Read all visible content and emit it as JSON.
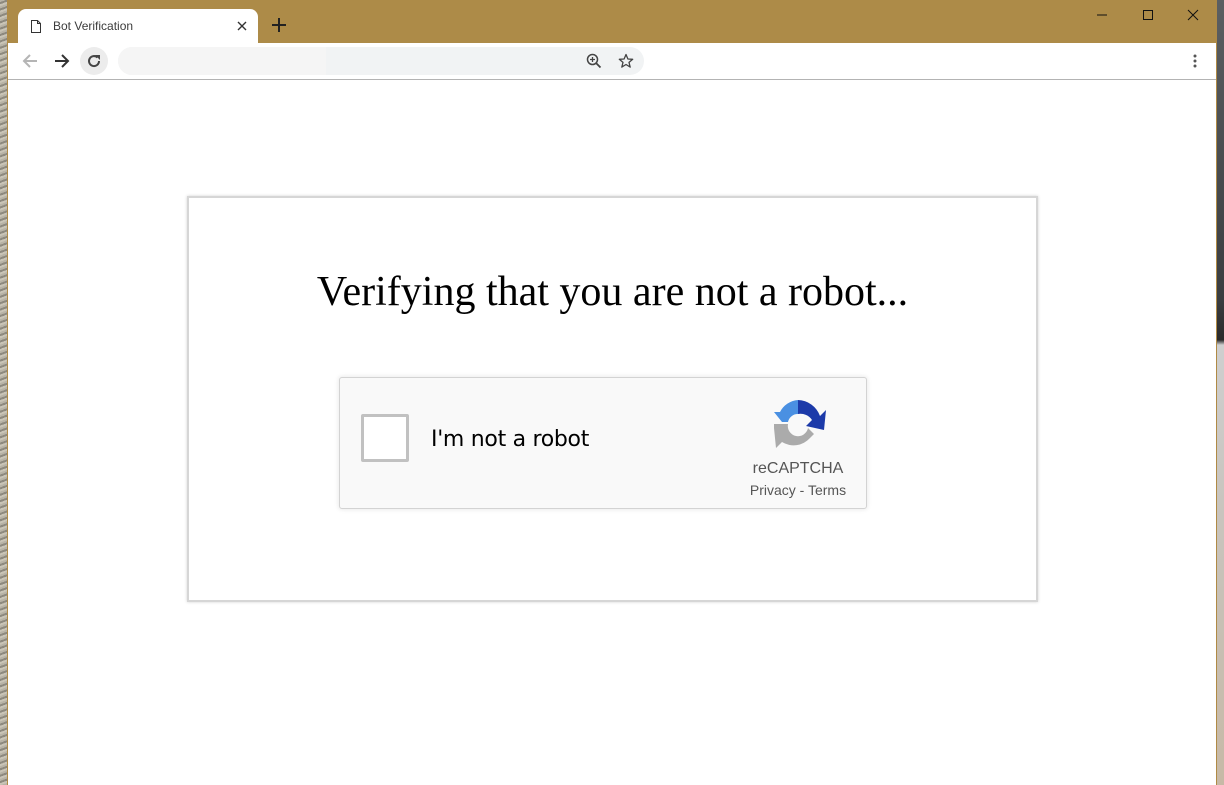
{
  "browser": {
    "tab": {
      "title": "Bot Verification",
      "icon": "page-icon",
      "close_icon": "close-icon"
    },
    "new_tab_label": "+",
    "window_controls": [
      "minimize-icon",
      "maximize-icon",
      "close-icon"
    ],
    "toolbar": {
      "back_icon": "arrow-left-icon",
      "forward_icon": "arrow-right-icon",
      "reload_icon": "reload-icon",
      "address_value": "",
      "zoom_icon": "zoom-in-icon",
      "bookmark_icon": "star-icon",
      "menu_icon": "kebab-menu-icon"
    }
  },
  "page": {
    "heading": "Verifying that you are not a robot...",
    "recaptcha": {
      "checkbox_label": "I'm not a robot",
      "checked": false,
      "brand": "reCAPTCHA",
      "privacy_link": "Privacy",
      "separator": " - ",
      "terms_link": "Terms",
      "logo_colors": {
        "light_blue": "#4a90e2",
        "dark_blue": "#1c3aa9",
        "gray": "#ababab"
      }
    }
  },
  "theme": {
    "titlebar_color": "#ad8b48",
    "omnibox_bg": "#f1f3f4"
  }
}
